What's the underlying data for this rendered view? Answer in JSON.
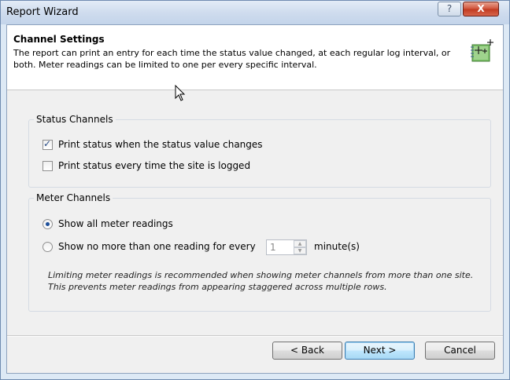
{
  "window": {
    "title": "Report Wizard",
    "help_label": "?",
    "close_label": "X"
  },
  "header": {
    "title": "Channel Settings",
    "description": "The report can print an entry for each time the status value changed, at each regular log interval, or both. Meter readings can be limited to one per every specific interval."
  },
  "status_channels": {
    "legend": "Status Channels",
    "options": [
      {
        "label": "Print status when the status value changes",
        "checked": true
      },
      {
        "label": "Print status every time the site is logged",
        "checked": false
      }
    ]
  },
  "meter_channels": {
    "legend": "Meter Channels",
    "options": [
      {
        "label": "Show all meter readings",
        "selected": true
      },
      {
        "label": "Show no more than one reading for every",
        "selected": false
      }
    ],
    "interval_value": "1",
    "interval_unit": "minute(s)",
    "note": "Limiting meter readings is recommended when showing meter channels from more than one site. This prevents meter readings from appearing staggered across multiple rows."
  },
  "buttons": {
    "back": "< Back",
    "next": "Next >",
    "cancel": "Cancel"
  },
  "colors": {
    "accent": "#3c7fb1",
    "close": "#c03a20",
    "titlebar": "#cfdcee"
  },
  "icons": [
    "help-icon",
    "close-icon",
    "wizard-sparkle-icon",
    "mouse-cursor-icon",
    "spin-up-icon",
    "spin-down-icon"
  ]
}
